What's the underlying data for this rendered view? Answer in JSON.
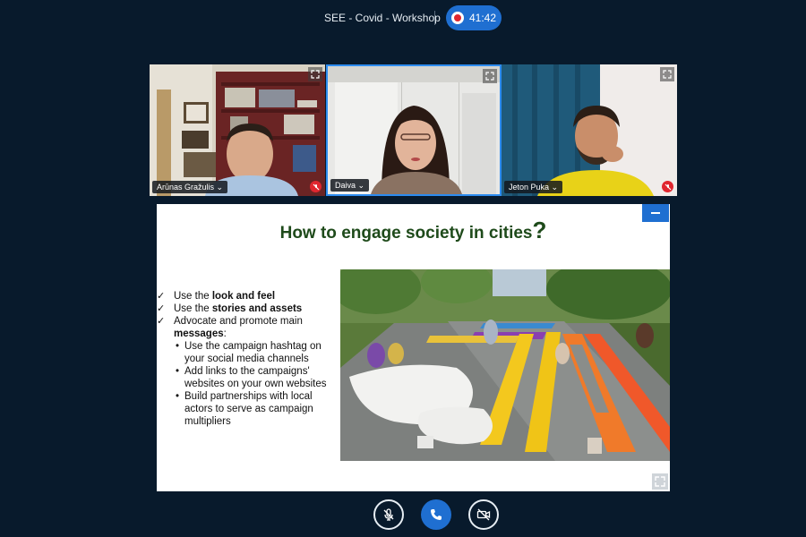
{
  "header": {
    "meeting_title": "SEE - Covid - Workshop",
    "recording_time": "41:42"
  },
  "participants": [
    {
      "name": "Arūnas Gražulis",
      "muted": true
    },
    {
      "name": "Daiva",
      "muted": false,
      "active_speaker": true
    },
    {
      "name": "Jeton Puka",
      "muted": true
    }
  ],
  "slide": {
    "title": "How to engage society in cities",
    "title_mark": "?",
    "bullet_1_prefix": "Use the ",
    "bullet_1_bold": "look and feel",
    "bullet_2_prefix": "Use the ",
    "bullet_2_bold": "stories and assets",
    "bullet_3_prefix": "Advocate and promote main ",
    "bullet_3_bold": "messages",
    "bullet_3_suffix": ":",
    "sub_bullets": [
      "Use the campaign hashtag on your social media channels",
      "Add links to the campaigns' websites on your own websites",
      "Build partnerships with local actors to serve as campaign multipliers"
    ]
  },
  "colors": {
    "background": "#081a2c",
    "accent": "#1f6fd1",
    "title_green": "#1e4a1a",
    "muted_red": "#e0262f"
  },
  "icons": {
    "expand": "expand-icon",
    "mic_off": "mic-off-icon",
    "phone": "phone-icon",
    "video_off": "video-off-icon",
    "minimize": "minimize-icon",
    "fullscreen": "fullscreen-icon"
  }
}
